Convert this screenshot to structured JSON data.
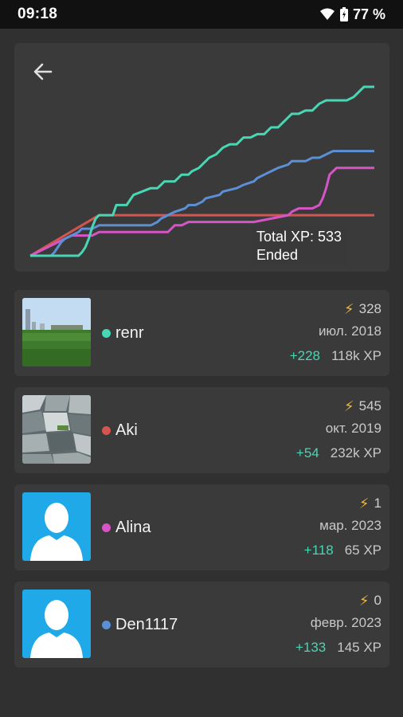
{
  "status": {
    "time": "09:18",
    "battery": "77 %"
  },
  "chart": {
    "overlay_total": "Total XP: 533",
    "overlay_status": "Ended"
  },
  "chart_data": {
    "type": "line",
    "title": "",
    "xlabel": "",
    "ylabel": "",
    "xlim": [
      0,
      100
    ],
    "ylim": [
      0,
      100
    ],
    "grid": false,
    "series": [
      {
        "color": "#48d6b4",
        "x": [
          0,
          14,
          15,
          16,
          17,
          18,
          19,
          20,
          24,
          25,
          28,
          30,
          35,
          37,
          38,
          39,
          42,
          44,
          46,
          47,
          49,
          50,
          51,
          52,
          54,
          55,
          56,
          58,
          60,
          61,
          62,
          64,
          66,
          68,
          69,
          70,
          72,
          74,
          75,
          76,
          78,
          80,
          82,
          84,
          86,
          88,
          90,
          92,
          94,
          95,
          96,
          97,
          98,
          99,
          100
        ],
        "values": [
          0,
          0,
          2,
          5,
          10,
          17,
          22,
          24,
          24,
          30,
          30,
          36,
          40,
          40,
          42,
          44,
          44,
          48,
          48,
          50,
          52,
          54,
          56,
          58,
          60,
          62,
          64,
          66,
          66,
          68,
          70,
          70,
          72,
          72,
          74,
          76,
          76,
          80,
          82,
          84,
          84,
          86,
          86,
          90,
          92,
          92,
          92,
          92,
          94,
          96,
          98,
          100,
          100,
          100,
          100
        ]
      },
      {
        "color": "#5b8fd6",
        "x": [
          0,
          6,
          7,
          8,
          9,
          10,
          12,
          14,
          15,
          18,
          20,
          22,
          30,
          35,
          37,
          38,
          40,
          42,
          45,
          46,
          48,
          50,
          51,
          55,
          56,
          60,
          62,
          65,
          66,
          68,
          70,
          72,
          75,
          76,
          80,
          82,
          83,
          84,
          86,
          88,
          90,
          92,
          95,
          100
        ],
        "values": [
          0,
          0,
          2,
          5,
          8,
          10,
          12,
          14,
          16,
          16,
          18,
          18,
          18,
          18,
          20,
          22,
          24,
          26,
          28,
          30,
          30,
          32,
          34,
          36,
          38,
          40,
          42,
          44,
          46,
          48,
          50,
          52,
          54,
          56,
          56,
          58,
          58,
          58,
          60,
          62,
          62,
          62,
          62,
          62
        ]
      },
      {
        "color": "#d655c6",
        "x": [
          0,
          2,
          4,
          6,
          8,
          10,
          12,
          18,
          20,
          25,
          30,
          35,
          40,
          42,
          44,
          46,
          48,
          50,
          55,
          60,
          65,
          70,
          75,
          76,
          78,
          80,
          82,
          84,
          85,
          86,
          87,
          88,
          89,
          90,
          92,
          95,
          100
        ],
        "values": [
          0,
          2,
          4,
          6,
          8,
          10,
          12,
          12,
          14,
          14,
          14,
          14,
          14,
          18,
          18,
          20,
          20,
          20,
          20,
          20,
          20,
          22,
          24,
          26,
          28,
          28,
          28,
          30,
          34,
          40,
          48,
          50,
          52,
          52,
          52,
          52,
          52
        ]
      },
      {
        "color": "#d45550",
        "x": [
          0,
          20,
          40,
          60,
          80,
          100
        ],
        "values": [
          0,
          24,
          24,
          24,
          24,
          24
        ]
      }
    ]
  },
  "users": [
    {
      "name": "renr",
      "dot_color": "#48d6b4",
      "energy": "328",
      "joined": "июл. 2018",
      "delta": "+228",
      "xp": "118k XP",
      "avatar": "photo-field"
    },
    {
      "name": "Aki",
      "dot_color": "#d45550",
      "energy": "545",
      "joined": "окт. 2019",
      "delta": "+54",
      "xp": "232k XP",
      "avatar": "photo-rocks"
    },
    {
      "name": "Alina",
      "dot_color": "#d655c6",
      "energy": "1",
      "joined": "мар. 2023",
      "delta": "+118",
      "xp": "65 XP",
      "avatar": "default-person"
    },
    {
      "name": "Den1117",
      "dot_color": "#5b8fd6",
      "energy": "0",
      "joined": "февр. 2023",
      "delta": "+133",
      "xp": "145 XP",
      "avatar": "default-person"
    }
  ]
}
